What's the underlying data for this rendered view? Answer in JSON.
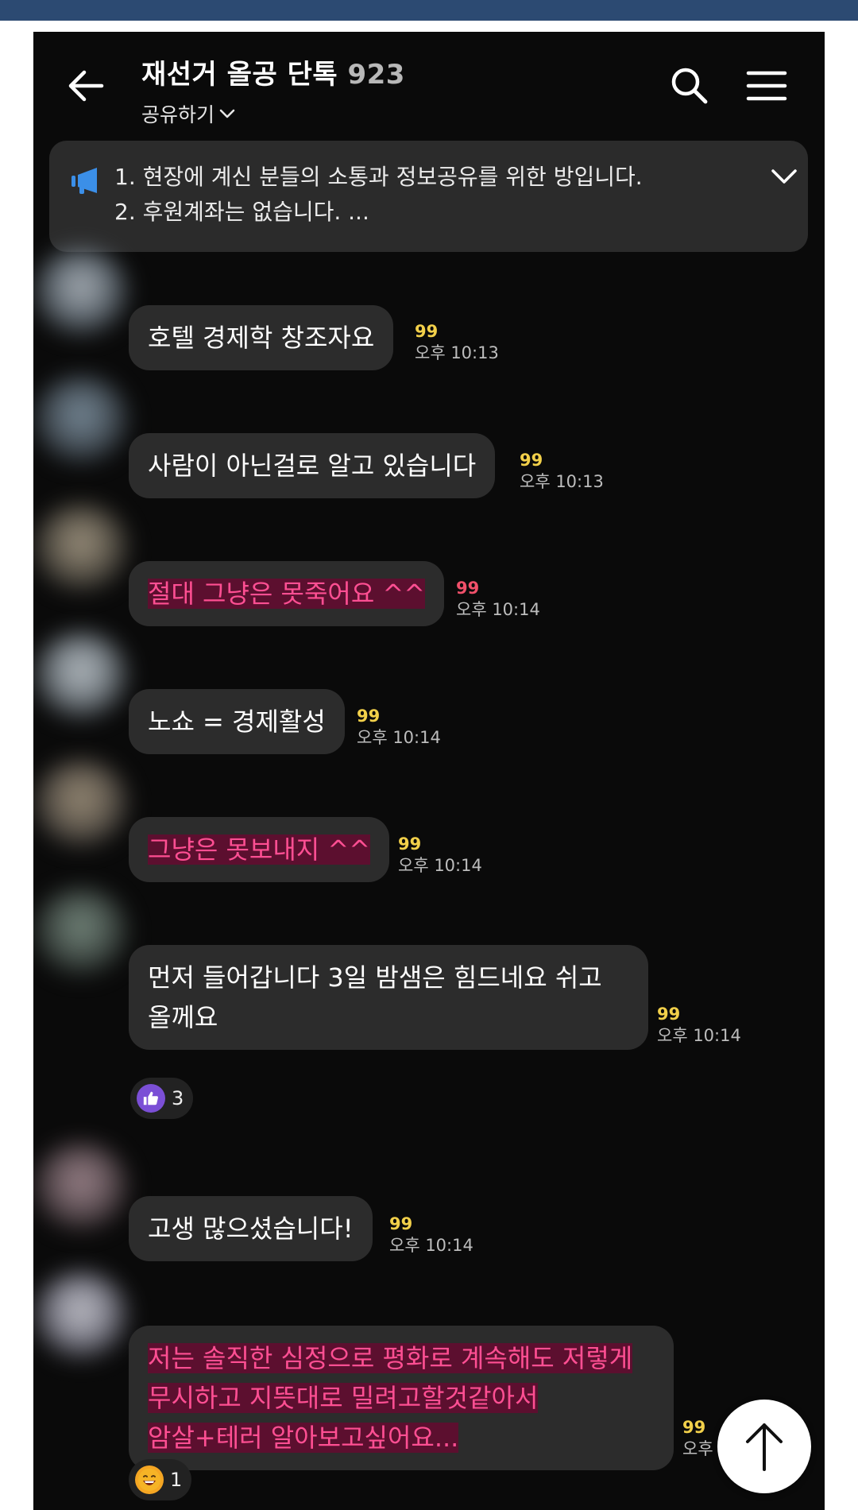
{
  "header": {
    "title": "재선거 올공 단톡",
    "member_count": "923",
    "share_label": "공유하기"
  },
  "notice": {
    "line1": "1. 현장에 계신 분들의 소통과 정보공유를 위한 방입니다.",
    "line2": "2. 후원계좌는 없습니다.  ..."
  },
  "messages": [
    {
      "text": "호텔 경제학 창조자요",
      "unread": "99",
      "time": "오후 10:13"
    },
    {
      "text": "사람이 아닌걸로 알고 있습니다",
      "unread": "99",
      "time": "오후 10:13"
    },
    {
      "text": "절대 그냥은 못죽어요 ^^",
      "unread": "99",
      "time": "오후 10:14",
      "highlight": true
    },
    {
      "text": "노쇼 = 경제활성",
      "unread": "99",
      "time": "오후 10:14"
    },
    {
      "text": "그냥은 못보내지 ^^",
      "unread": "99",
      "time": "오후 10:14",
      "highlight": true
    },
    {
      "lines": [
        "먼저 들어갑니다 3일 밤샘은 힘드네요 쉬고",
        "올께요"
      ],
      "unread": "99",
      "time": "오후 10:14",
      "reaction": {
        "icon": "thumbs-up-icon",
        "count": "3"
      }
    },
    {
      "text": "고생 많으셨습니다!",
      "unread": "99",
      "time": "오후 10:14"
    },
    {
      "lines": [
        "저는 솔직한 심정으로 평화로 계속해도 저렇게",
        "무시하고 지뜻대로 밀려고할것같아서",
        "암살+테러 알아보고싶어요..."
      ],
      "unread": "99",
      "time": "오후 10:14",
      "highlight": true,
      "reaction": {
        "icon": "grinning-face-icon",
        "count": "1"
      }
    }
  ],
  "colors": {
    "background": "#0a0a0a",
    "bubble": "#2c2c2c",
    "highlight_text": "#ff4f93",
    "unread": "#f2d04a",
    "notice_icon": "#3b8fe8",
    "thumbs_reaction": "#7b4fd6"
  }
}
